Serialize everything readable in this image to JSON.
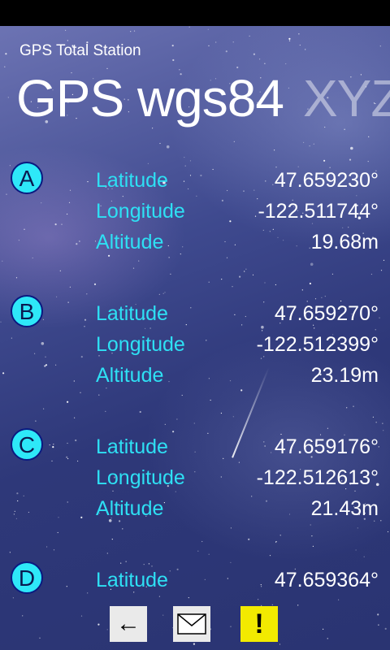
{
  "app": {
    "title": "GPS Total Station"
  },
  "pivot": {
    "active": "GPS wgs84",
    "next": "XYZ"
  },
  "points": [
    {
      "letter": "A",
      "rows": [
        {
          "label": "Latitude",
          "value": "47.659230°"
        },
        {
          "label": "Longitude",
          "value": "-122.511744°"
        },
        {
          "label": "Altitude",
          "value": "19.68m"
        }
      ]
    },
    {
      "letter": "B",
      "rows": [
        {
          "label": "Latitude",
          "value": "47.659270°"
        },
        {
          "label": "Longitude",
          "value": "-122.512399°"
        },
        {
          "label": "Altitude",
          "value": "23.19m"
        }
      ]
    },
    {
      "letter": "C",
      "rows": [
        {
          "label": "Latitude",
          "value": "47.659176°"
        },
        {
          "label": "Longitude",
          "value": "-122.512613°"
        },
        {
          "label": "Altitude",
          "value": "21.43m"
        }
      ]
    },
    {
      "letter": "D",
      "rows": [
        {
          "label": "Latitude",
          "value": "47.659364°"
        }
      ]
    }
  ],
  "app_bar": {
    "buttons": [
      {
        "icon": "back-arrow-icon",
        "glyph": "←",
        "color": "#eaeaea"
      },
      {
        "icon": "mail-icon",
        "color": "#eaeaea"
      },
      {
        "icon": "warning-icon",
        "glyph": "!",
        "color": "#f2ea00"
      }
    ]
  },
  "colors": {
    "accent": "#2ee0f4",
    "badge": "#2ee8f8",
    "text": "#ffffff",
    "warning": "#f2ea00"
  }
}
